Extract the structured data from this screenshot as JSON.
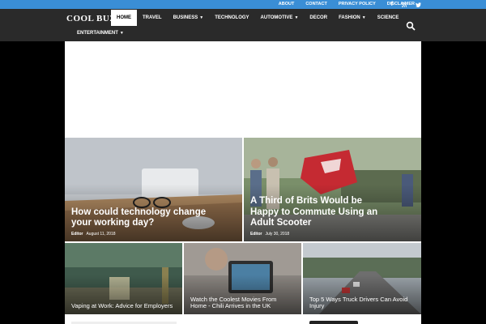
{
  "topbar": {
    "links": [
      "ABOUT",
      "CONTACT",
      "PRIVACY POLICY",
      "DISCLAIMER"
    ],
    "social_icons": [
      "facebook-icon",
      "rss-icon",
      "twitter-icon"
    ],
    "social_glyphs": [
      "f",
      "ʃ",
      "t"
    ]
  },
  "header": {
    "logo": "COOL BUZZ",
    "menu_row1": [
      {
        "label": "HOME",
        "active": true,
        "dropdown": false
      },
      {
        "label": "TRAVEL",
        "active": false,
        "dropdown": false
      },
      {
        "label": "BUSINESS",
        "active": false,
        "dropdown": true
      },
      {
        "label": "TECHNOLOGY",
        "active": false,
        "dropdown": false
      },
      {
        "label": "AUTOMOTIVE",
        "active": false,
        "dropdown": true
      },
      {
        "label": "DECOR",
        "active": false,
        "dropdown": false
      },
      {
        "label": "FASHION",
        "active": false,
        "dropdown": true
      },
      {
        "label": "SCIENCE",
        "active": false,
        "dropdown": false
      }
    ],
    "menu_row2": [
      {
        "label": "ENTERTAINMENT",
        "dropdown": true
      }
    ],
    "search_icon": "search-icon"
  },
  "featured": [
    {
      "title": "How could technology change your working day?",
      "author": "Editor",
      "date": "August 11, 2018",
      "colors": [
        "#c9ccd1",
        "#a07a52"
      ]
    },
    {
      "title": "A Third of Brits Would be Happy to Commute Using an Adult Scooter",
      "author": "Editor",
      "date": "July 30, 2018",
      "colors": [
        "#6f8a5a",
        "#c0282f"
      ]
    }
  ],
  "secondary": [
    {
      "title": "Vaping at Work: Advice for Employers",
      "colors": [
        "#3f5a4c",
        "#a8a06a"
      ]
    },
    {
      "title": "Watch the Coolest Movies From Home - Chili Arrives in the UK",
      "colors": [
        "#8a8580",
        "#4b7fa3"
      ]
    },
    {
      "title": "Top 5 Ways Truck Drivers Can Avoid Injury",
      "colors": [
        "#6b7d6a",
        "#9aa2a8"
      ]
    }
  ]
}
